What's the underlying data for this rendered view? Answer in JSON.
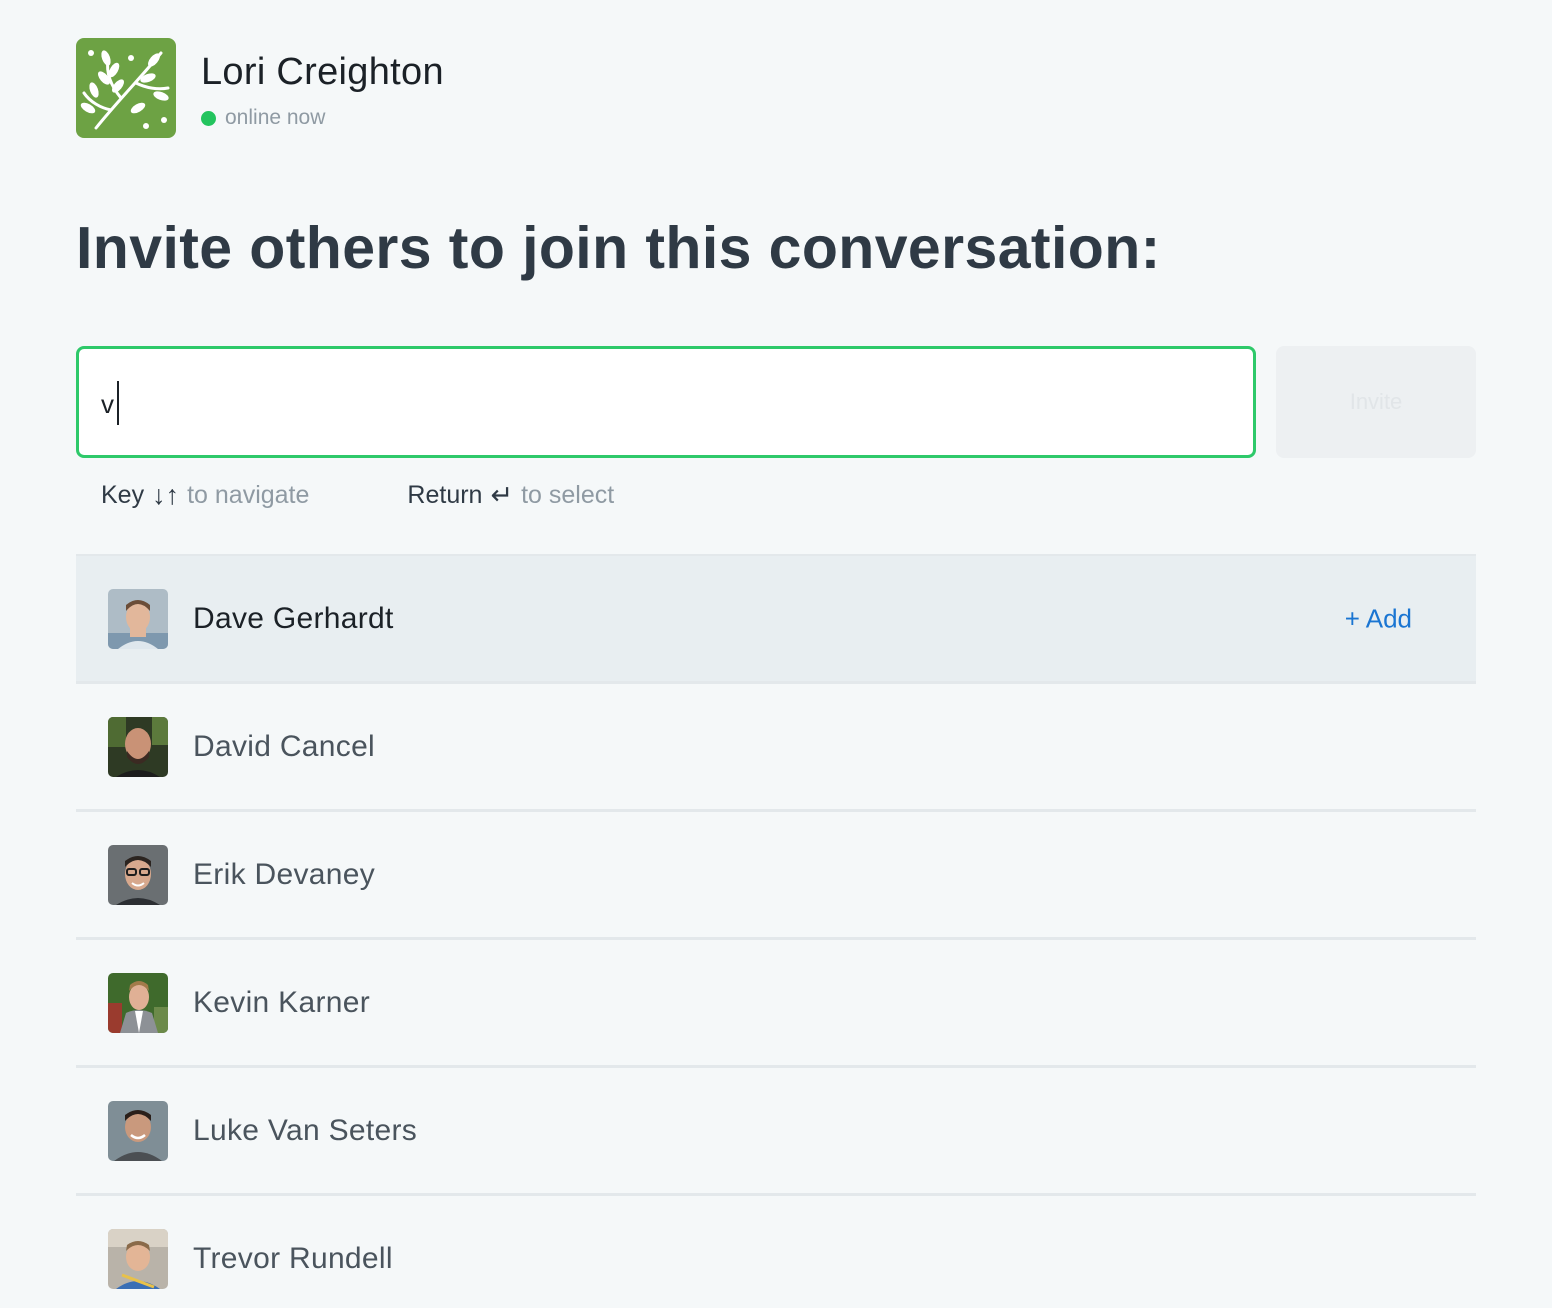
{
  "header": {
    "user_name": "Lori Creighton",
    "status": "online now",
    "logo_icon": "leaf-branch-icon"
  },
  "title": "Invite others to join this conversation:",
  "search": {
    "value": "v"
  },
  "invite_button": {
    "label": "Invite"
  },
  "hints": {
    "navigate": {
      "key": "Key",
      "glyph": "↓↑",
      "desc": "to navigate"
    },
    "select": {
      "key": "Return",
      "glyph": "↵",
      "desc": "to select"
    }
  },
  "people": [
    {
      "name": "Dave Gerhardt",
      "highlighted": true,
      "action": "+ Add"
    },
    {
      "name": "David Cancel"
    },
    {
      "name": "Erik Devaney"
    },
    {
      "name": "Kevin Karner"
    },
    {
      "name": "Luke Van Seters"
    },
    {
      "name": "Trevor Rundell"
    }
  ],
  "colors": {
    "accent_green": "#2ec96a",
    "online_dot": "#23c45e",
    "link_blue": "#1a75d2",
    "logo_green": "#6da244"
  }
}
